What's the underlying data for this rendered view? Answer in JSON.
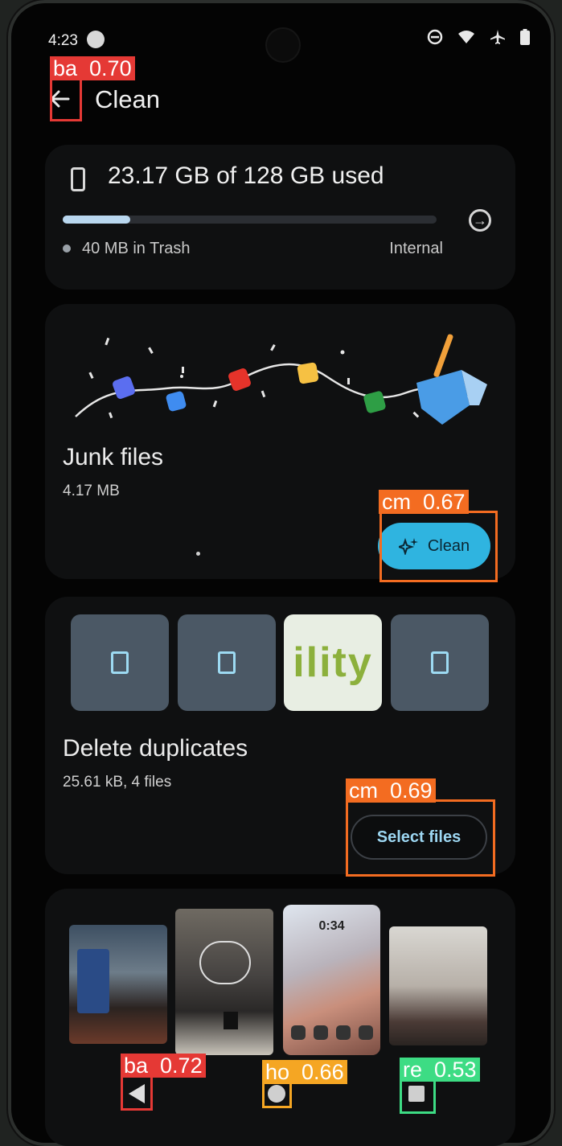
{
  "status_bar": {
    "time": "4:23",
    "icons": [
      "dnd-icon",
      "wifi-icon",
      "airplane-icon",
      "battery-icon"
    ]
  },
  "header": {
    "title": "Clean"
  },
  "storage": {
    "summary": "23.17 GB of 128 GB used",
    "used_fraction": 0.181,
    "trash": "40 MB in Trash",
    "location": "Internal"
  },
  "junk": {
    "title": "Junk files",
    "size": "4.17 MB",
    "button": "Clean"
  },
  "duplicates": {
    "title": "Delete duplicates",
    "summary": "25.61 kB, 4 files",
    "button": "Select files",
    "preview_text": "ility"
  },
  "overlays": [
    {
      "label": "ba  0.70",
      "color": "#e53935"
    },
    {
      "label": "cm  0.67",
      "color": "#f36c21"
    },
    {
      "label": "cm  0.69",
      "color": "#f36c21"
    },
    {
      "label": "ba  0.72",
      "color": "#e53935"
    },
    {
      "label": "ho  0.66",
      "color": "#f5a623"
    },
    {
      "label": "re  0.53",
      "color": "#3ddc84"
    }
  ],
  "screenshot_preview": {
    "lockscreen_time": "0:34"
  },
  "colors": {
    "accent": "#2fb4e0",
    "background": "#040404",
    "card": "#0f1011"
  }
}
